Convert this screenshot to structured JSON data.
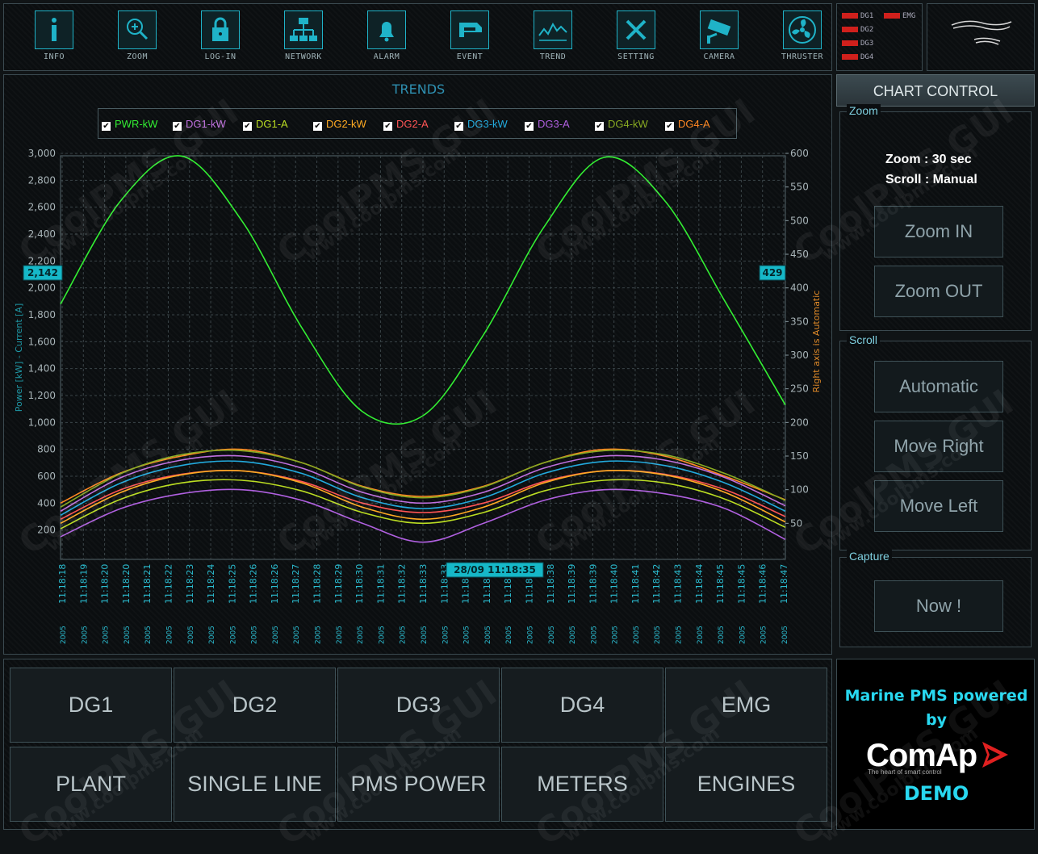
{
  "toolbar": {
    "items": [
      {
        "label": "INFO",
        "icon": "info-icon"
      },
      {
        "label": "ZOOM",
        "icon": "zoom-icon"
      },
      {
        "label": "LOG-IN",
        "icon": "lock-icon"
      },
      {
        "label": "NETWORK",
        "icon": "network-icon"
      },
      {
        "label": "ALARM",
        "icon": "bell-icon"
      },
      {
        "label": "EVENT",
        "icon": "event-icon"
      },
      {
        "label": "TREND",
        "icon": "trend-icon"
      },
      {
        "label": "SETTING",
        "icon": "tools-icon"
      },
      {
        "label": "CAMERA",
        "icon": "camera-icon"
      },
      {
        "label": "THRUSTER",
        "icon": "fan-icon"
      }
    ],
    "accent": "#1fb3c8"
  },
  "status": {
    "items": [
      "DG1",
      "EMG",
      "DG2",
      "DG3",
      "DG4"
    ],
    "led_color": "#d0201c"
  },
  "chart": {
    "title": "TRENDS",
    "left_marker": "2,142",
    "right_marker": "429",
    "cursor_label": "28/09 11:18:35",
    "left_axis_label": "Power [kW] - Current [A]",
    "right_axis_label": "Right axis is Automatic",
    "legend": [
      {
        "name": "PWR-kW",
        "color": "#33ee33",
        "checked": true
      },
      {
        "name": "DG1-kW",
        "color": "#c070e0",
        "checked": true
      },
      {
        "name": "DG1-A",
        "color": "#bbdd22",
        "checked": true
      },
      {
        "name": "DG2-kW",
        "color": "#ffaa22",
        "checked": true
      },
      {
        "name": "DG2-A",
        "color": "#ff5555",
        "checked": true
      },
      {
        "name": "DG3-kW",
        "color": "#22aadd",
        "checked": true
      },
      {
        "name": "DG3-A",
        "color": "#b060e0",
        "checked": true
      },
      {
        "name": "DG4-kW",
        "color": "#88aa22",
        "checked": true
      },
      {
        "name": "DG4-A",
        "color": "#ff8822",
        "checked": true
      }
    ]
  },
  "chart_data": {
    "type": "line",
    "x": [
      "11:18:18",
      "11:18:19",
      "11:18:20",
      "11:18:20",
      "11:18:21",
      "11:18:22",
      "11:18:23",
      "11:18:24",
      "11:18:25",
      "11:18:26",
      "11:18:26",
      "11:18:27",
      "11:18:28",
      "11:18:29",
      "11:18:30",
      "11:18:31",
      "11:18:32",
      "11:18:33",
      "11:18:33",
      "11:18:34",
      "11:18:35",
      "11:18:36",
      "11:18:37",
      "11:18:38",
      "11:18:39",
      "11:18:39",
      "11:18:40",
      "11:18:41",
      "11:18:42",
      "11:18:43",
      "11:18:44",
      "11:18:45",
      "11:18:45",
      "11:18:46",
      "11:18:47"
    ],
    "x_date_label": "2005",
    "y_left_ticks": [
      "3,000",
      "2,800",
      "2,600",
      "2,400",
      "2,200",
      "2,000",
      "1,800",
      "1,600",
      "1,400",
      "1,200",
      "1,000",
      "800",
      "600",
      "400",
      "200"
    ],
    "y_right_ticks": [
      "600",
      "550",
      "500",
      "450",
      "400",
      "350",
      "300",
      "250",
      "200",
      "150",
      "100",
      "50"
    ],
    "ylim_left": [
      0,
      3000
    ],
    "ylim_right": [
      0,
      600
    ],
    "grid": true,
    "series": [
      {
        "name": "PWR-kW",
        "axis": "left",
        "values": [
          1880,
          2650,
          2980,
          2500,
          1700,
          1080,
          1050,
          1650,
          2450,
          2970,
          2650,
          1900,
          1130
        ]
      },
      {
        "name": "DG4-A",
        "axis": "right",
        "values": [
          80,
          125,
          150,
          160,
          140,
          105,
          90,
          105,
          140,
          160,
          150,
          120,
          85
        ]
      },
      {
        "name": "DG4-kW",
        "axis": "left",
        "values": [
          370,
          620,
          760,
          790,
          700,
          520,
          440,
          520,
          700,
          790,
          760,
          620,
          420
        ]
      },
      {
        "name": "DG1-kW",
        "axis": "left",
        "values": [
          340,
          590,
          720,
          750,
          660,
          480,
          400,
          480,
          660,
          750,
          720,
          590,
          380
        ]
      },
      {
        "name": "DG3-kW",
        "axis": "left",
        "values": [
          310,
          550,
          680,
          710,
          620,
          440,
          360,
          440,
          620,
          710,
          680,
          550,
          340
        ]
      },
      {
        "name": "DG2-A",
        "axis": "right",
        "values": [
          56,
          100,
          123,
          128,
          112,
          80,
          66,
          80,
          112,
          128,
          123,
          100,
          60
        ]
      },
      {
        "name": "DG2-kW",
        "axis": "left",
        "values": [
          250,
          480,
          610,
          640,
          550,
          370,
          280,
          370,
          550,
          640,
          610,
          480,
          260
        ]
      },
      {
        "name": "DG1-A",
        "axis": "right",
        "values": [
          42,
          86,
          110,
          114,
          98,
          66,
          50,
          66,
          98,
          114,
          110,
          86,
          44
        ]
      },
      {
        "name": "DG3-A",
        "axis": "right",
        "values": [
          30,
          72,
          94,
          100,
          84,
          50,
          22,
          50,
          84,
          100,
          94,
          72,
          26
        ]
      }
    ]
  },
  "chart_control": {
    "header": "CHART CONTROL",
    "zoom_title": "Zoom",
    "zoom_text": "Zoom : 30 sec",
    "scroll_text": "Scroll : Manual",
    "zoom_in": "Zoom IN",
    "zoom_out": "Zoom OUT",
    "scroll_title": "Scroll",
    "automatic": "Automatic",
    "move_right": "Move Right",
    "move_left": "Move Left",
    "capture_title": "Capture",
    "now": "Now !"
  },
  "nav": {
    "row1": [
      "DG1",
      "DG2",
      "DG3",
      "DG4",
      "EMG"
    ],
    "row2": [
      "PLANT",
      "SINGLE LINE",
      "PMS POWER",
      "METERS",
      "ENGINES"
    ]
  },
  "brand": {
    "line1": "Marine PMS powered",
    "line2": "by",
    "logo": "ComAp",
    "tagline": "The heart of smart control",
    "demo": "DEMO",
    "color": "#28d8f0"
  },
  "watermark": {
    "title": "CoolPMS GUI",
    "url": "www.coolpms.com"
  }
}
